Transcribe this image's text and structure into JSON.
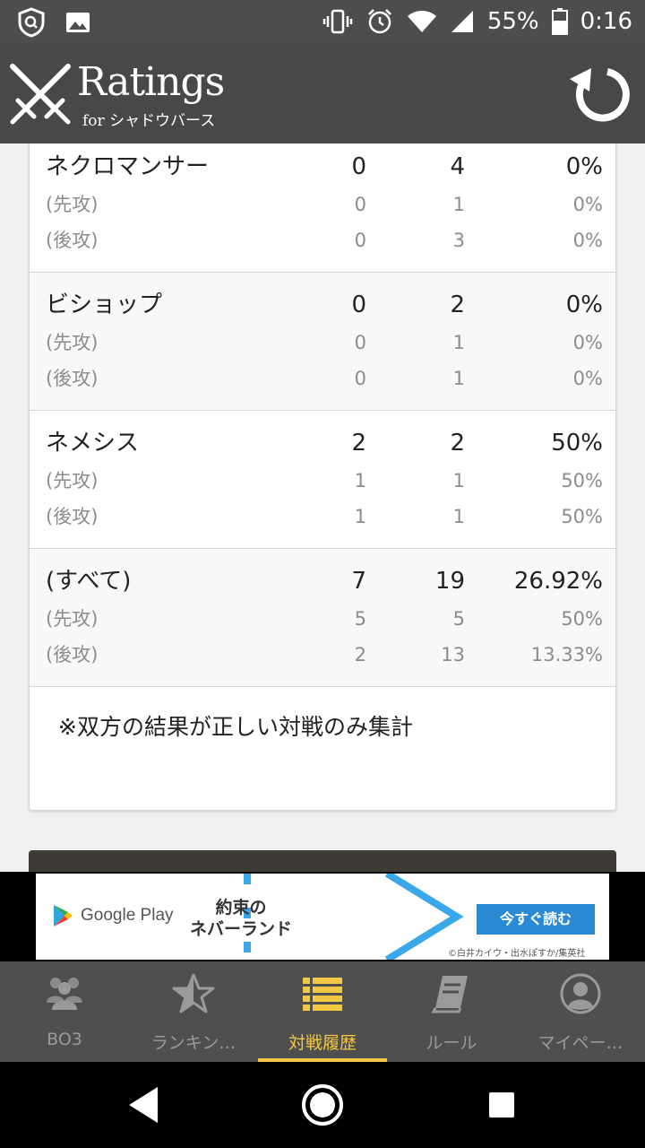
{
  "status_bar": {
    "battery": "55%",
    "time": "0:16"
  },
  "app": {
    "title": "Ratings",
    "subtitle": "for シャドウバース"
  },
  "stats": {
    "groups": [
      {
        "name": "ネクロマンサー",
        "wins": "0",
        "losses": "4",
        "rate": "0%",
        "first": {
          "label": "(先攻)",
          "wins": "0",
          "losses": "1",
          "rate": "0%"
        },
        "second": {
          "label": "(後攻)",
          "wins": "0",
          "losses": "3",
          "rate": "0%"
        }
      },
      {
        "name": "ビショップ",
        "wins": "0",
        "losses": "2",
        "rate": "0%",
        "first": {
          "label": "(先攻)",
          "wins": "0",
          "losses": "1",
          "rate": "0%"
        },
        "second": {
          "label": "(後攻)",
          "wins": "0",
          "losses": "1",
          "rate": "0%"
        }
      },
      {
        "name": "ネメシス",
        "wins": "2",
        "losses": "2",
        "rate": "50%",
        "first": {
          "label": "(先攻)",
          "wins": "1",
          "losses": "1",
          "rate": "50%"
        },
        "second": {
          "label": "(後攻)",
          "wins": "1",
          "losses": "1",
          "rate": "50%"
        }
      },
      {
        "name": "(すべて)",
        "wins": "7",
        "losses": "19",
        "rate": "26.92%",
        "first": {
          "label": "(先攻)",
          "wins": "5",
          "losses": "5",
          "rate": "50%"
        },
        "second": {
          "label": "(後攻)",
          "wins": "2",
          "losses": "13",
          "rate": "13.33%"
        }
      }
    ],
    "note": "※双方の結果が正しい対戦のみ集計"
  },
  "ad": {
    "store": "Google Play",
    "title_line1": "約束の",
    "title_line2": "ネバーランド",
    "cta": "今すぐ読む",
    "credit": "©白井カイウ・出水ぽすか/集英社"
  },
  "bottom_nav": [
    {
      "label": "BO3",
      "icon": "users-icon"
    },
    {
      "label": "ランキン…",
      "icon": "star-icon"
    },
    {
      "label": "対戦履歴",
      "icon": "list-icon",
      "active": true
    },
    {
      "label": "ルール",
      "icon": "book-icon"
    },
    {
      "label": "マイペー…",
      "icon": "account-icon"
    }
  ],
  "colors": {
    "accent": "#f2c744",
    "app_bar": "#484848",
    "nav_bg": "#4f4f4f"
  }
}
